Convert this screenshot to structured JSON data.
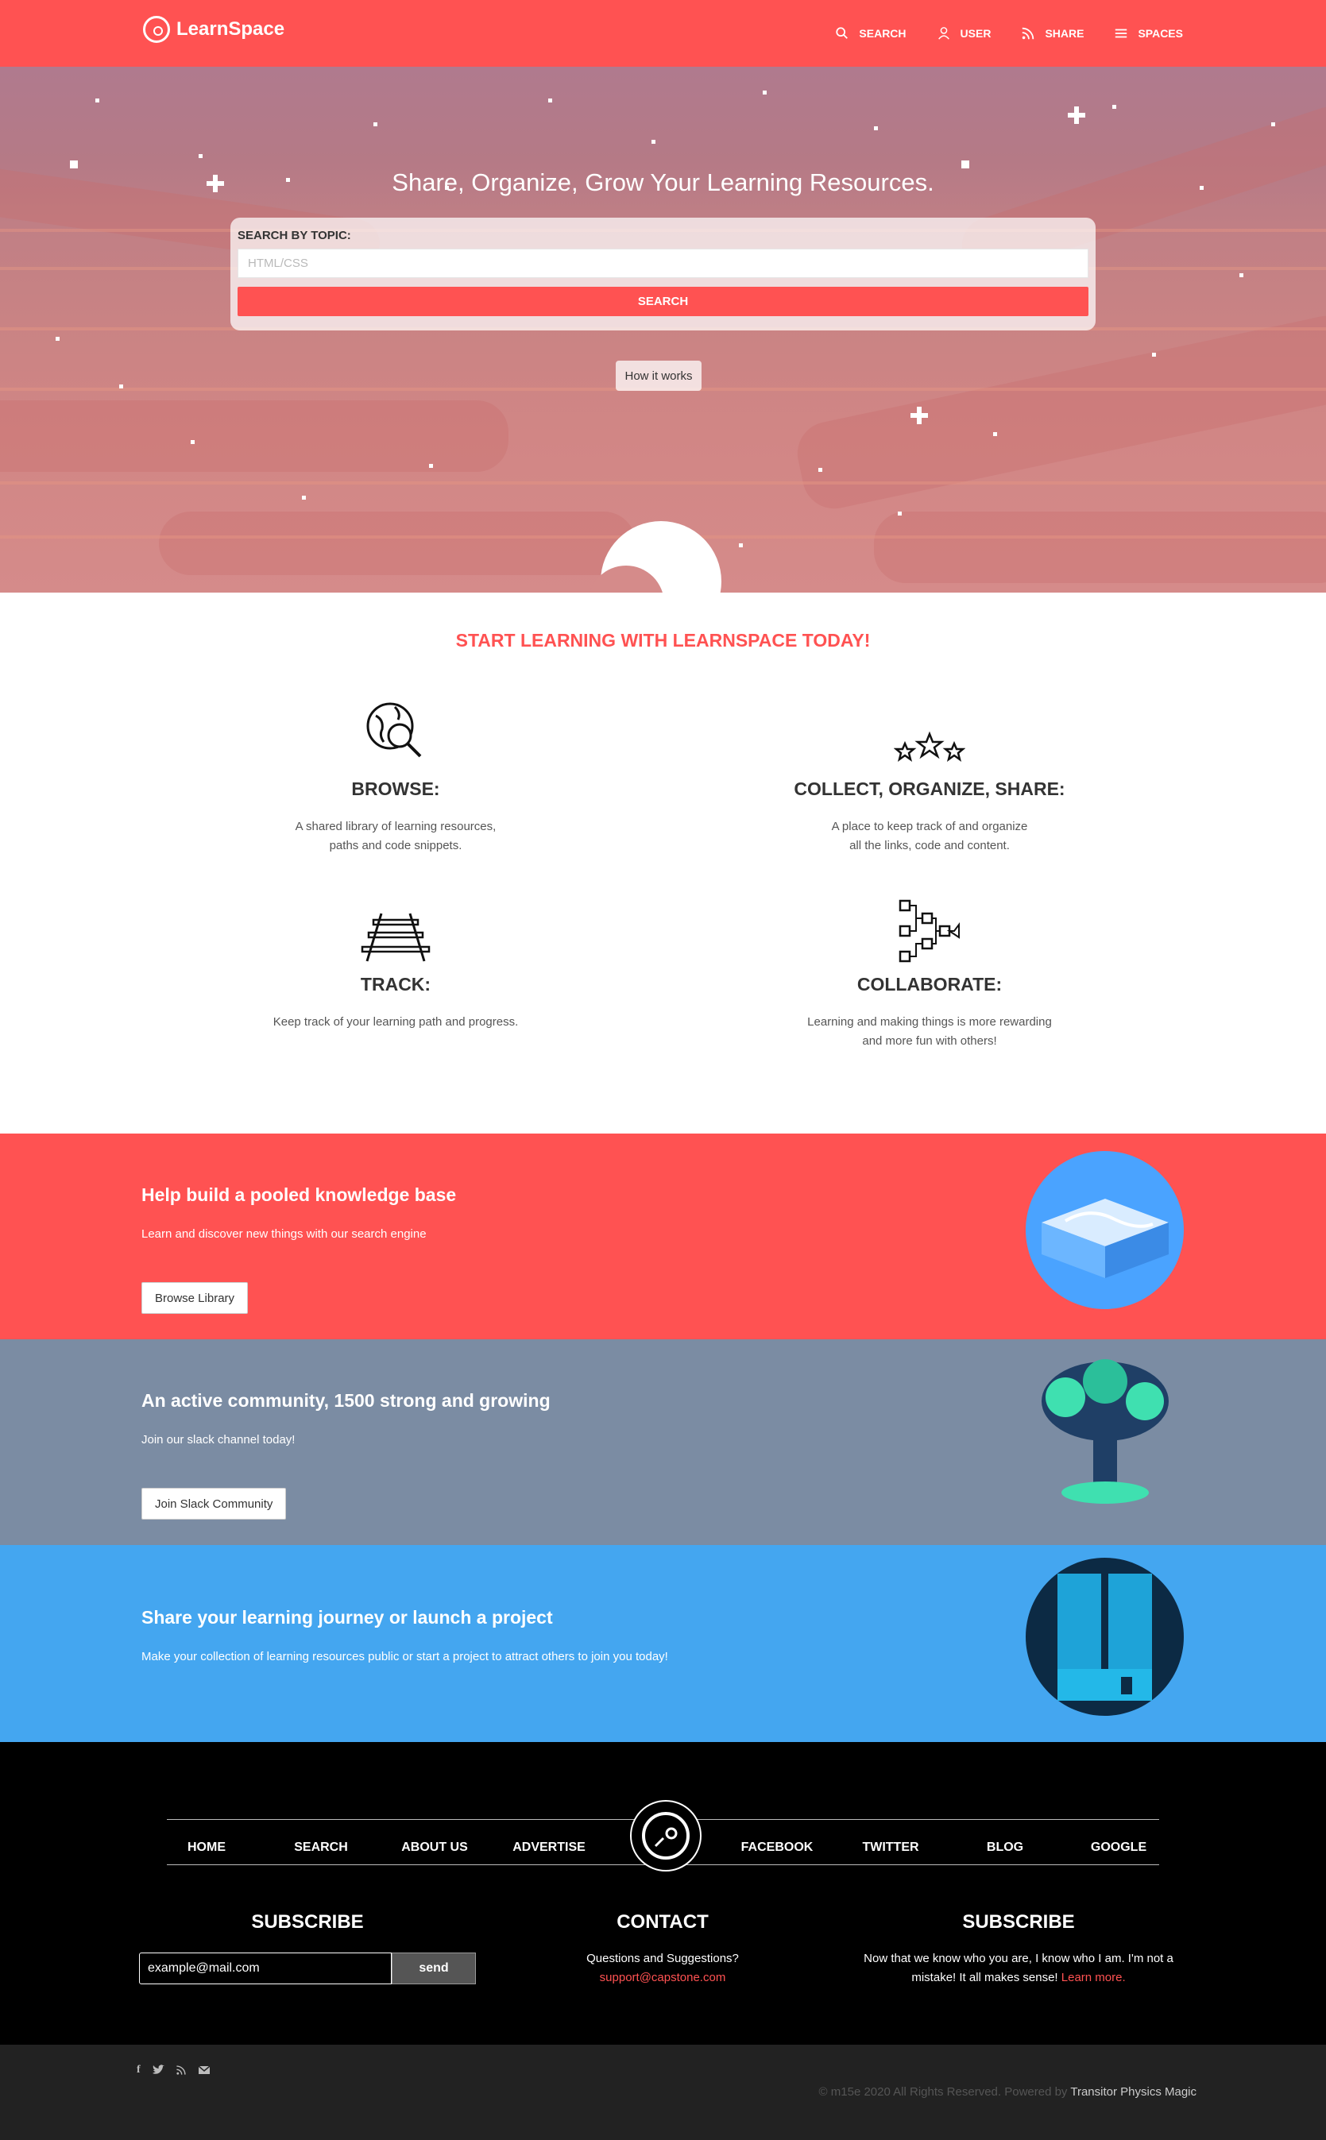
{
  "header": {
    "brand": "LearnSpace",
    "nav": [
      {
        "label": "SEARCH",
        "icon": "search-icon"
      },
      {
        "label": "USER",
        "icon": "user-icon"
      },
      {
        "label": "SHARE",
        "icon": "rss-icon"
      },
      {
        "label": "SPACES",
        "icon": "menu-icon"
      }
    ]
  },
  "hero": {
    "title": "Share, Organize, Grow Your Learning Resources.",
    "search_label": "SEARCH BY TOPIC:",
    "search_placeholder": "HTML/CSS",
    "search_button": "SEARCH",
    "how_button": "How it works"
  },
  "features": {
    "title": "START LEARNING WITH LEARNSPACE TODAY!",
    "items": [
      {
        "heading": "BROWSE:",
        "text": "A shared library of learning resources,\npaths and code snippets.",
        "icon": "globe-search-icon"
      },
      {
        "heading": "COLLECT, ORGANIZE, SHARE:",
        "text": "A place to keep track of and organize\nall the links, code and content.",
        "icon": "stars-icon"
      },
      {
        "heading": "TRACK:",
        "text": "Keep track of your learning path and progress.",
        "icon": "railroad-track-icon"
      },
      {
        "heading": "COLLABORATE:",
        "text": "Learning and making things is more rewarding\nand more fun with others!",
        "icon": "flowchart-icon"
      }
    ]
  },
  "bands": [
    {
      "heading": "Help build a pooled knowledge base",
      "text": "Learn and discover new things with our search engine",
      "button": "Browse Library",
      "color": "#ff5252"
    },
    {
      "heading": "An active community, 1500 strong and growing",
      "text": "Join our slack channel today!",
      "button": "Join Slack Community",
      "color": "#7b8ca3"
    },
    {
      "heading": "Share your learning journey or launch a project",
      "text": "Make your collection of learning resources public or start a project to attract others to join you today!",
      "color": "#44a6f0"
    }
  ],
  "footer": {
    "nav_left": [
      "HOME",
      "SEARCH",
      "ABOUT US",
      "ADVERTISE"
    ],
    "nav_right": [
      "FACEBOOK",
      "TWITTER",
      "BLOG",
      "GOOGLE"
    ],
    "subscribe_title": "SUBSCRIBE",
    "subscribe_placeholder": "example@mail.com",
    "subscribe_button": "send",
    "contact_title": "CONTACT",
    "contact_text": "Questions and Suggestions?",
    "contact_email": "support@capstone.com",
    "about_title": "SUBSCRIBE",
    "about_text": "Now that we know who you are, I know who I am. I'm not a mistake! It all makes sense!",
    "about_link": "Learn more.",
    "socials": [
      "f",
      "t",
      "rss",
      "mail"
    ],
    "copyright": "© m15e 2020 All Rights Reserved. Powered by",
    "powered_by": "Transitor Physics Magic"
  },
  "colors": {
    "accent": "#ff5252",
    "community": "#7b8ca3",
    "share": "#44a6f0",
    "footer": "#000000"
  }
}
